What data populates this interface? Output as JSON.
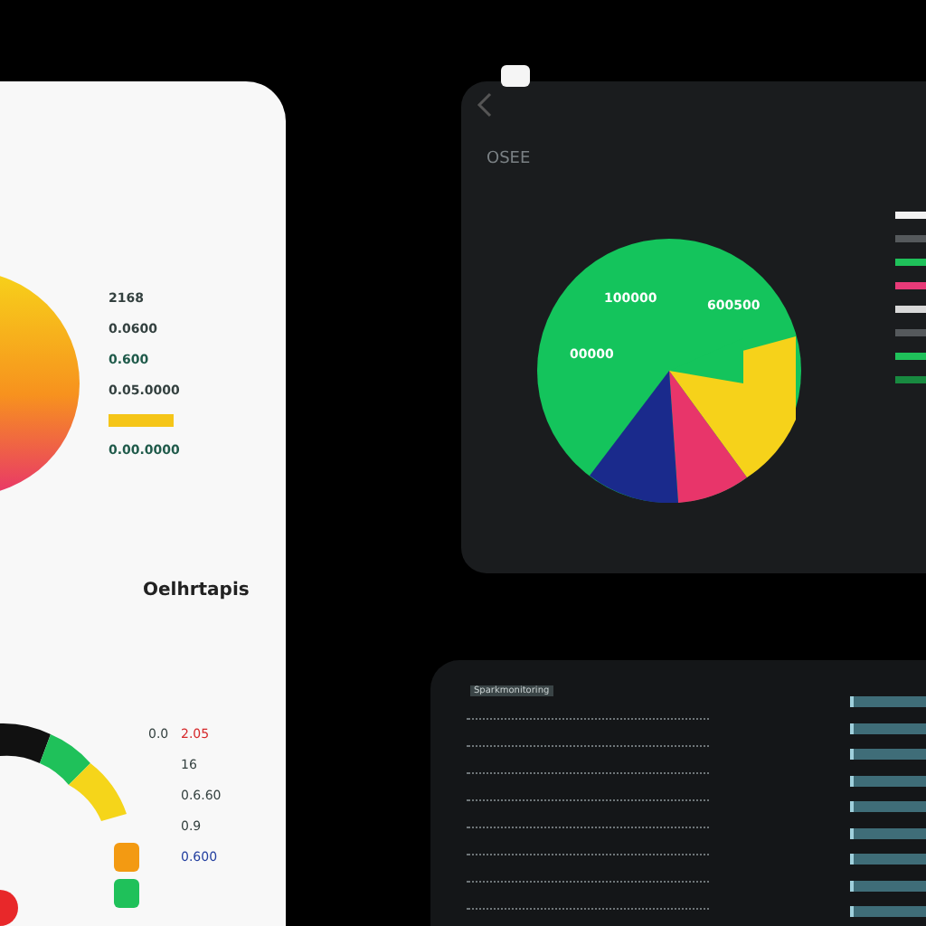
{
  "light_card": {
    "legend": [
      {
        "kind": "text",
        "label": "2168",
        "color": "#33403f"
      },
      {
        "kind": "text",
        "label": "0.0600",
        "color": "#33403f"
      },
      {
        "kind": "text",
        "label": "0.600",
        "color": "#1f5a4a"
      },
      {
        "kind": "text",
        "label": "0.05.0000",
        "color": "#33403f"
      },
      {
        "kind": "swatch",
        "color": "#f5c518"
      },
      {
        "kind": "text",
        "label": "0.00.0000",
        "color": "#1f5a4a"
      }
    ],
    "heading": "Oelhrtapis",
    "gauge_labels": [
      {
        "label": "0.0",
        "color": "#33403f"
      },
      {
        "label": "2.05",
        "color": "#d6282a"
      },
      {
        "label": "16",
        "color": "#33403f"
      },
      {
        "label": "0.6.60",
        "color": "#33403f"
      },
      {
        "label": "0.9",
        "color": "#33403f"
      },
      {
        "label": "0.600",
        "color": "#2440a0"
      }
    ]
  },
  "dark_card": {
    "title": "OSEE",
    "pie_labels": [
      "100000",
      "600500",
      "00000"
    ],
    "legend_bars": [
      {
        "color": "#f2f2f2"
      },
      {
        "color": "#55595c"
      },
      {
        "color": "#1fc15a"
      },
      {
        "color": "#e83a78"
      },
      {
        "color": "#d8d8d8"
      },
      {
        "color": "#55595c"
      },
      {
        "color": "#1fc15a"
      },
      {
        "color": "#188a40"
      }
    ]
  },
  "table_card": {
    "header": "Sparkmonitoring"
  }
}
